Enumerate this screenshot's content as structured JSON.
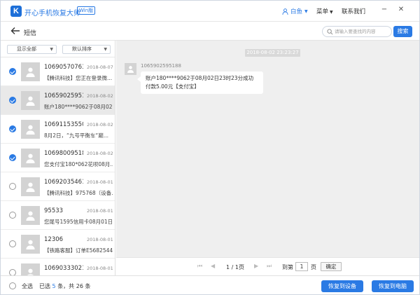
{
  "app": {
    "logo_letter": "K",
    "title": "开心手机恢复大师",
    "edition_badge": "Win版",
    "user_name": "白鱼",
    "menu_label": "菜单",
    "contact_label": "联系我们",
    "accent_color": "#2a7ae4"
  },
  "header": {
    "title": "短信",
    "search_placeholder": "请输入要查找的内容",
    "search_button": "搜索"
  },
  "filters": {
    "show": "显示全部",
    "sort": "默认排序"
  },
  "messages": [
    {
      "name": "10690570763...",
      "date": "2018-08-07",
      "preview": "【腾讯科技】您正在登录微...",
      "checked": true,
      "selected": false
    },
    {
      "name": "10659025951...",
      "date": "2018-08-02",
      "preview": "账户180****9062于08月02...",
      "checked": true,
      "selected": true
    },
    {
      "name": "106911535500",
      "date": "2018-08-02",
      "preview": "8月2日，“九号平衡车“巅...",
      "checked": true,
      "selected": false
    },
    {
      "name": "106980095188",
      "date": "2018-08-02",
      "preview": "您支付宝180*062花呗08月...",
      "checked": true,
      "selected": false
    },
    {
      "name": "10692035461...",
      "date": "2018-08-01",
      "preview": "【腾讯科技】975768（设备...",
      "checked": false,
      "selected": false
    },
    {
      "name": "95533",
      "date": "2018-08-01",
      "preview": "您尾号1595信用卡08月01日...",
      "checked": false,
      "selected": false
    },
    {
      "name": "12306",
      "date": "2018-08-01",
      "preview": "【铁路客服】订单E5682544...",
      "checked": false,
      "selected": false
    },
    {
      "name": "10690333021...",
      "date": "2018-08-01",
      "preview": "",
      "checked": false,
      "selected": false
    }
  ],
  "conversation": {
    "timestamp": "2018-08-02 23:23:27",
    "sender": "1065902595188",
    "text": "账户180****9062于08月02日23时23分成功付款5.00元【支付宝】"
  },
  "pager": {
    "current": "1 / 1页",
    "goto_label": "到第",
    "goto_value": "1",
    "page_unit": "页",
    "confirm": "确定"
  },
  "footer": {
    "select_all": "全选",
    "selected_prefix": "已选",
    "selected_count": "5",
    "selected_suffix": "条，共 26 条",
    "restore_device": "恢复到设备",
    "restore_pc": "恢复到电脑"
  }
}
